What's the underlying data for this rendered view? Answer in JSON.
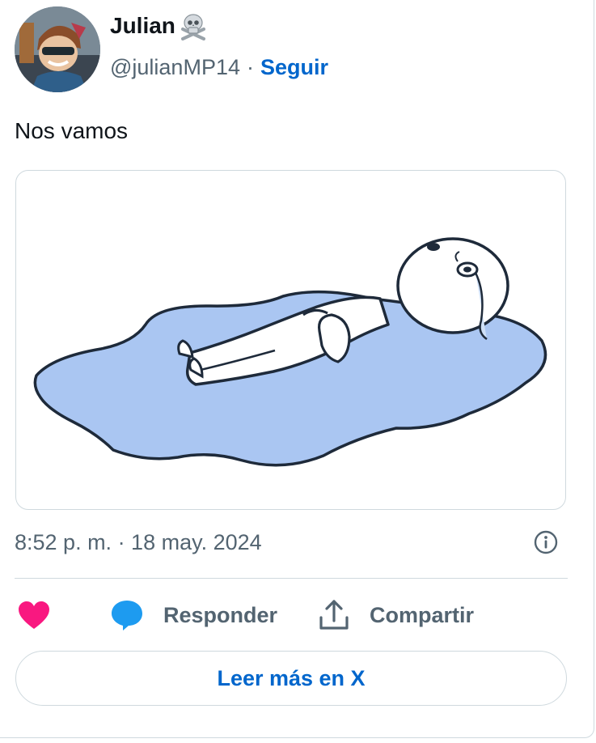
{
  "author": {
    "display_name": "Julian",
    "handle": "@julianMP14",
    "separator": "·",
    "follow_label": "Seguir"
  },
  "tweet": {
    "text": "Nos vamos",
    "timestamp": "8:52 p. m. · 18 may. 2024"
  },
  "actions": {
    "reply_label": "Responder",
    "share_label": "Compartir"
  },
  "read_more_label": "Leer más en X",
  "icons": {
    "avatar": "cartoon-avatar",
    "name_emoji": "skull-crossbones-icon",
    "info": "info-icon",
    "like": "heart-icon",
    "reply": "speech-bubble-icon",
    "share": "upload-icon"
  },
  "colors": {
    "link": "#0066cc",
    "secondary_text": "#536471",
    "heart": "#f91880",
    "reply_bubble": "#1d9bf0",
    "puddle": "#a9c6f3",
    "border": "#cfd9de"
  }
}
